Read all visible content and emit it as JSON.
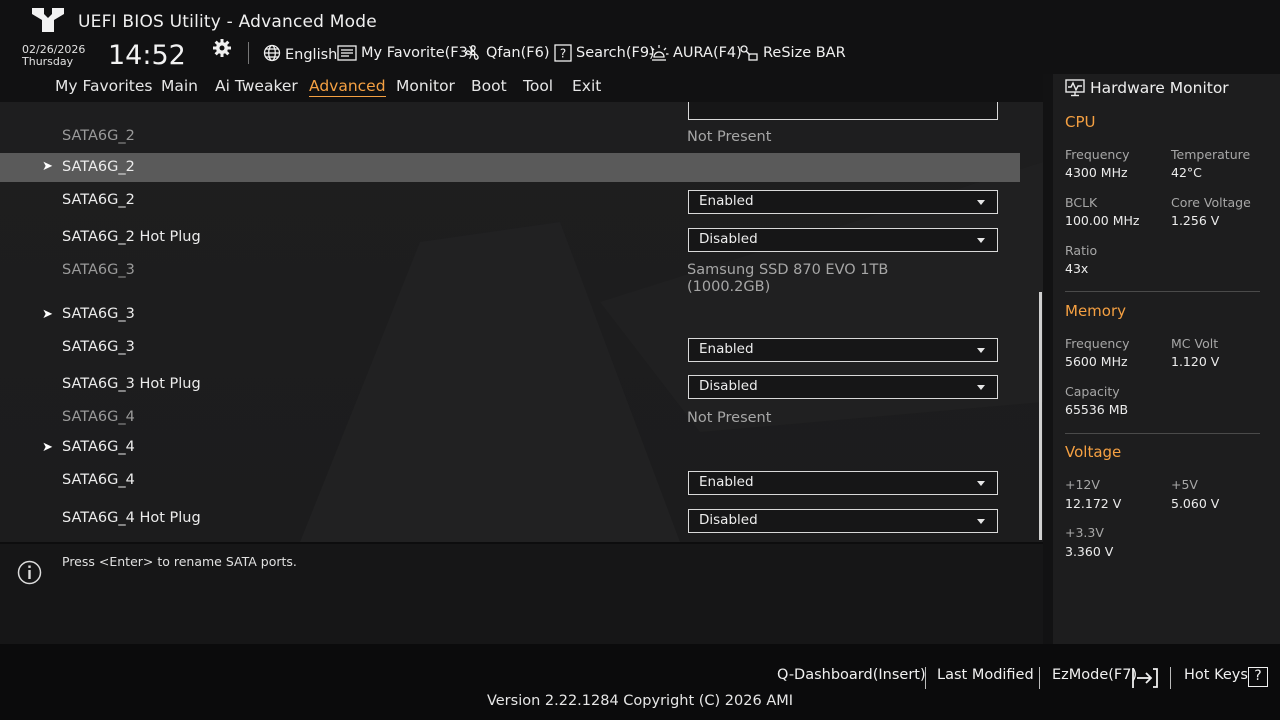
{
  "header": {
    "title": "UEFI BIOS Utility - Advanced Mode",
    "date": "02/26/2026",
    "day": "Thursday",
    "time": "14:52",
    "tools": {
      "language": "English",
      "favorite": "My Favorite(F3)",
      "qfan": "Qfan(F6)",
      "search": "Search(F9)",
      "aura": "AURA(F4)",
      "resize_bar": "ReSize BAR"
    }
  },
  "tabs": [
    "My Favorites",
    "Main",
    "Ai Tweaker",
    "Advanced",
    "Monitor",
    "Boot",
    "Tool",
    "Exit"
  ],
  "active_tab": "Advanced",
  "settings": {
    "rows": [
      {
        "label": "SATA6G_2",
        "value": "Not Present"
      },
      {
        "label": "SATA6G_2"
      },
      {
        "label": "SATA6G_2",
        "value": "Enabled"
      },
      {
        "label": "SATA6G_2 Hot Plug",
        "value": "Disabled"
      },
      {
        "label": "SATA6G_3",
        "value": "Samsung SSD 870 EVO 1TB",
        "value2": "(1000.2GB)"
      },
      {
        "label": "SATA6G_3"
      },
      {
        "label": "SATA6G_3",
        "value": "Enabled"
      },
      {
        "label": "SATA6G_3 Hot Plug",
        "value": "Disabled"
      },
      {
        "label": "SATA6G_4",
        "value": "Not Present"
      },
      {
        "label": "SATA6G_4"
      },
      {
        "label": "SATA6G_4",
        "value": "Enabled"
      },
      {
        "label": "SATA6G_4 Hot Plug",
        "value": "Disabled"
      }
    ],
    "submenu_arrow": "➤"
  },
  "help": {
    "text": "Press <Enter> to rename SATA ports."
  },
  "hardware_monitor": {
    "title": "Hardware Monitor",
    "cpu": {
      "heading": "CPU",
      "frequency_label": "Frequency",
      "frequency": "4300 MHz",
      "temperature_label": "Temperature",
      "temperature": "42°C",
      "bclk_label": "BCLK",
      "bclk": "100.00 MHz",
      "core_voltage_label": "Core Voltage",
      "core_voltage": "1.256 V",
      "ratio_label": "Ratio",
      "ratio": "43x"
    },
    "memory": {
      "heading": "Memory",
      "frequency_label": "Frequency",
      "frequency": "5600 MHz",
      "mc_volt_label": "MC Volt",
      "mc_volt": "1.120 V",
      "capacity_label": "Capacity",
      "capacity": "65536 MB"
    },
    "voltage": {
      "heading": "Voltage",
      "v12_label": "+12V",
      "v12": "12.172 V",
      "v5_label": "+5V",
      "v5": "5.060 V",
      "v33_label": "+3.3V",
      "v33": "3.360 V"
    }
  },
  "footer": {
    "q_dashboard": "Q-Dashboard(Insert)",
    "last_modified": "Last Modified",
    "ezmode": "EzMode(F7)",
    "hot_keys": "Hot Keys",
    "hot_keys_glyph": "?",
    "version": "Version 2.22.1284 Copyright (C) 2026 AMI"
  },
  "colors": {
    "accent": "#f5a042",
    "selection": "#5a5a5a",
    "background": "#121213"
  }
}
